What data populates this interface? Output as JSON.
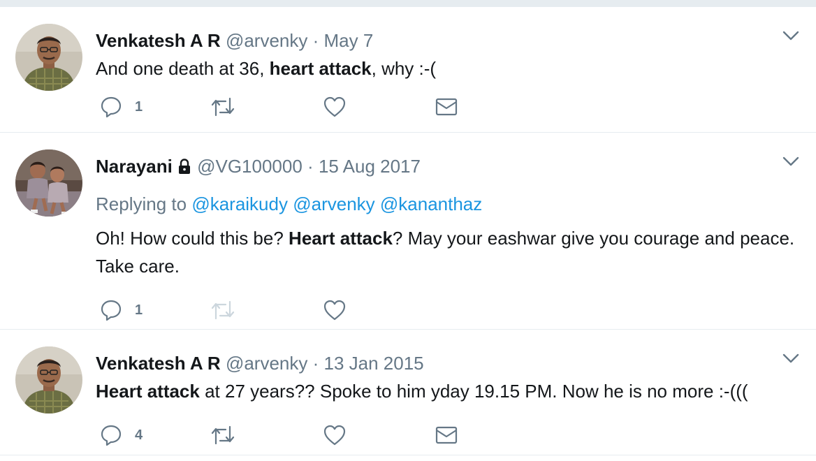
{
  "tweets": [
    {
      "name": "Venkatesh A R",
      "handle": "@arvenky",
      "separator": "·",
      "date": "May 7",
      "text_parts": [
        "And one death at 36, ",
        "heart attack",
        ", why :-("
      ],
      "reply_count": "1",
      "avatar": "man-glasses-plaid-shirt"
    },
    {
      "name": "Narayani",
      "handle": "@VG100000",
      "separator": "·",
      "date": "15 Aug 2017",
      "protected": true,
      "replying_label": "Replying to ",
      "mentions": [
        "@karaikudy",
        "@arvenky",
        "@kananthaz"
      ],
      "text_parts": [
        "Oh! How could this be? ",
        "Heart attack",
        "? May your eashwar give you courage and peace. Take care."
      ],
      "reply_count": "1",
      "avatar": "two-children-photo"
    },
    {
      "name": "Venkatesh A R",
      "handle": "@arvenky",
      "separator": "·",
      "date": "13 Jan 2015",
      "text_parts": [
        "",
        "Heart attack",
        " at 27 years?? Spoke to him yday 19.15 PM. Now he is no more :-((("
      ],
      "reply_count": "4",
      "avatar": "man-glasses-plaid-shirt"
    }
  ],
  "icons": {
    "reply": "speech-bubble-icon",
    "retweet": "retweet-icon",
    "like": "heart-icon",
    "dm": "envelope-icon",
    "caret": "chevron-down-icon",
    "lock": "lock-icon"
  },
  "colors": {
    "text": "#14171a",
    "secondary": "#657786",
    "link": "#1b95e0",
    "border": "#e6ecf0",
    "disabled_icon": "#ccd6dd"
  }
}
